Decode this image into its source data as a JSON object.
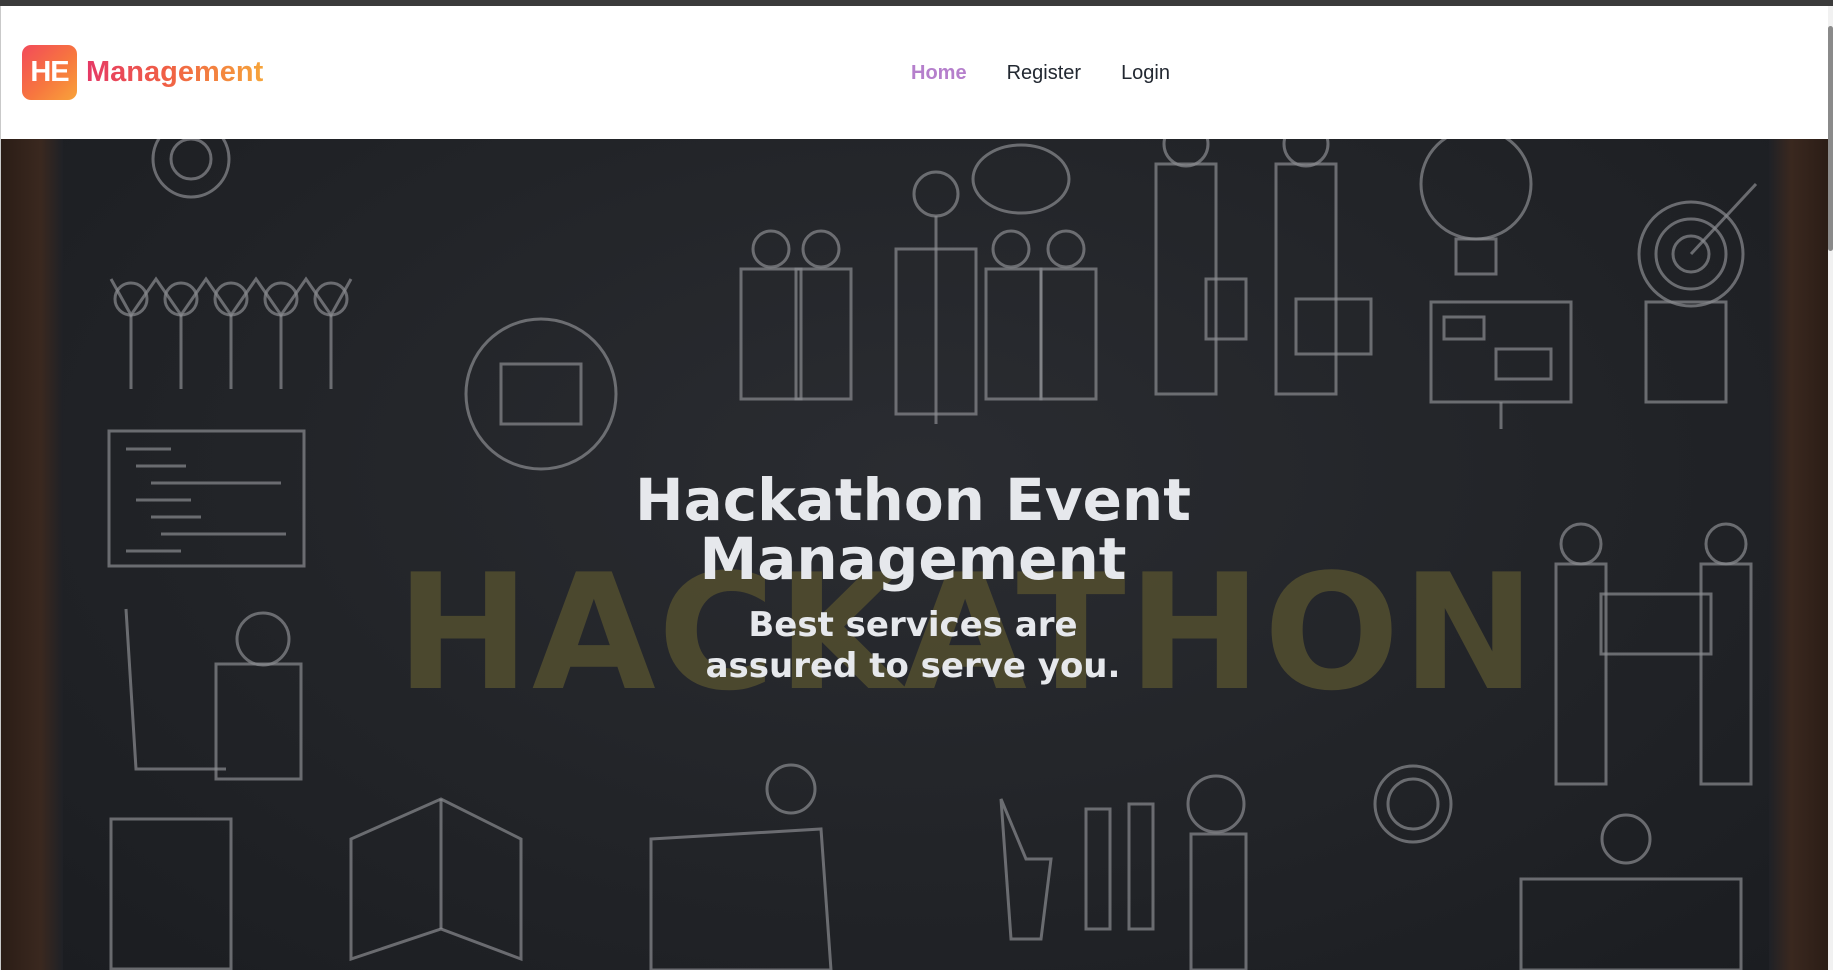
{
  "navbar": {
    "logo_badge": "HE",
    "logo_text": "Management",
    "links": [
      {
        "label": "Home",
        "active": true
      },
      {
        "label": "Register",
        "active": false
      },
      {
        "label": "Login",
        "active": false
      }
    ]
  },
  "hero": {
    "background_word": "HACKATHON",
    "title": "Hackathon Event Management",
    "subtitle": "Best services are assured to serve you."
  },
  "colors": {
    "accent_gradient": [
      "#f24a5a",
      "#f7763f",
      "#f8a33a"
    ],
    "active_link": "#b57fcc",
    "hero_text": "#e6e8ec"
  }
}
